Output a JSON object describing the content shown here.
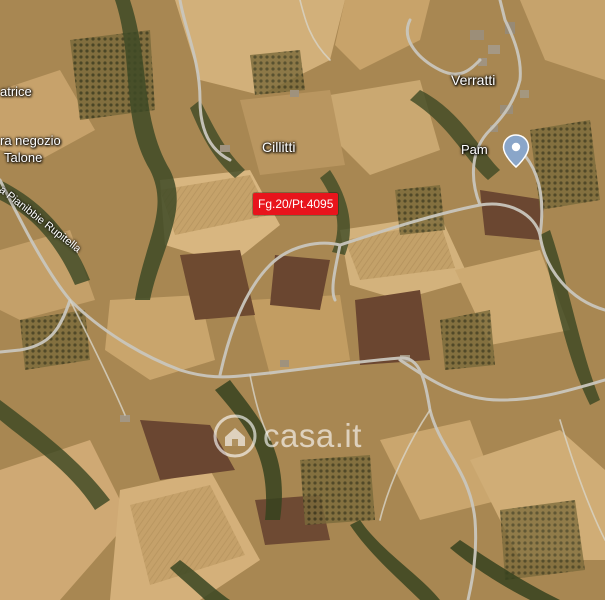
{
  "map": {
    "type": "satellite",
    "places": {
      "verratti": "Verratti",
      "cillitti": "Cillitti",
      "pam": "Pam",
      "atrice": "atrice",
      "negozio": "ra negozio",
      "talone": "Talone"
    },
    "road": "a Pianibbie Rupitella",
    "parcel_label": "Fg.20/Pt.4095",
    "pin_icon": "location-pin-icon"
  },
  "watermark": {
    "text": "casa.it",
    "icon": "house-icon"
  },
  "colors": {
    "parcel_bg": "#e8141c",
    "pin": "#8aa6c9",
    "road": "#c9c6bd"
  }
}
